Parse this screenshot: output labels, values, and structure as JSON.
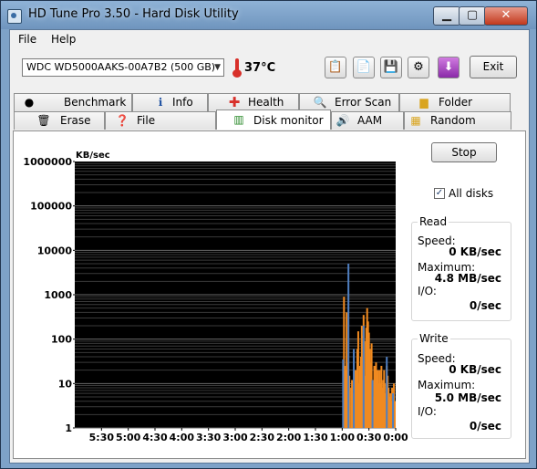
{
  "window": {
    "title": "HD Tune Pro 3.50 - Hard Disk Utility"
  },
  "menu": {
    "file": "File",
    "help": "Help"
  },
  "toolbar": {
    "drive": "WDC WD5000AAKS-00A7B2 (500 GB)",
    "temperature": "37°C",
    "exit_label": "Exit",
    "icons": [
      "copy-icon",
      "copy-info-icon",
      "save-icon",
      "options-icon",
      "download-icon"
    ]
  },
  "tabs": {
    "row1": [
      "Benchmark",
      "Info",
      "Health",
      "Error Scan",
      "Folder Usage"
    ],
    "row2": [
      "Erase",
      "File Benchmark",
      "Disk monitor",
      "AAM",
      "Random Access"
    ],
    "active": "Disk monitor"
  },
  "controls": {
    "stop_label": "Stop",
    "all_disks_label": "All disks",
    "all_disks_checked": true
  },
  "read": {
    "title": "Read",
    "speed_label": "Speed:",
    "speed": "0 KB/sec",
    "max_label": "Maximum:",
    "max": "4.8 MB/sec",
    "io_label": "I/O:",
    "io": "0/sec"
  },
  "write": {
    "title": "Write",
    "speed_label": "Speed:",
    "speed": "0 KB/sec",
    "max_label": "Maximum:",
    "max": "5.0 MB/sec",
    "io_label": "I/O:",
    "io": "0/sec"
  },
  "chart_data": {
    "type": "bar",
    "ylabel": "KB/sec",
    "y_scale": "log",
    "ylim": [
      1,
      1000000
    ],
    "yticks": [
      "1000000",
      "100000",
      "10000",
      "1000",
      "100",
      "10",
      "1"
    ],
    "xticks": [
      "5:30",
      "5:00",
      "4:30",
      "4:00",
      "3:30",
      "3:00",
      "2:30",
      "2:00",
      "1:30",
      "1:00",
      "0:30",
      "0:00"
    ],
    "xlim_seconds_ago": [
      360,
      0
    ],
    "series": [
      {
        "colorkey": "write",
        "color": "#f08a20",
        "points": [
          [
            58,
            900
          ],
          [
            57,
            25
          ],
          [
            56,
            20
          ],
          [
            55,
            400
          ],
          [
            54,
            30
          ],
          [
            52,
            15
          ],
          [
            50,
            8
          ],
          [
            49,
            12
          ],
          [
            48,
            6
          ],
          [
            46,
            8
          ],
          [
            45,
            20
          ],
          [
            44,
            15
          ],
          [
            43,
            60
          ],
          [
            42,
            150
          ],
          [
            41,
            10
          ],
          [
            40,
            25
          ],
          [
            39,
            40
          ],
          [
            38,
            200
          ],
          [
            37,
            120
          ],
          [
            36,
            350
          ],
          [
            35,
            90
          ],
          [
            34,
            15
          ],
          [
            33,
            180
          ],
          [
            32,
            500
          ],
          [
            31,
            250
          ],
          [
            30,
            140
          ],
          [
            29,
            60
          ],
          [
            28,
            30
          ],
          [
            27,
            80
          ],
          [
            26,
            8
          ],
          [
            25,
            5
          ],
          [
            24,
            25
          ],
          [
            23,
            12
          ],
          [
            22,
            30
          ],
          [
            21,
            15
          ],
          [
            20,
            20
          ],
          [
            19,
            10
          ],
          [
            18,
            20
          ],
          [
            17,
            10
          ],
          [
            16,
            25
          ],
          [
            15,
            8
          ],
          [
            14,
            12
          ],
          [
            13,
            20
          ],
          [
            12,
            6
          ],
          [
            11,
            10
          ],
          [
            10,
            25
          ],
          [
            9,
            15
          ],
          [
            8,
            8
          ],
          [
            7,
            5
          ],
          [
            6,
            6
          ],
          [
            5,
            4
          ],
          [
            4,
            8
          ],
          [
            3,
            5
          ],
          [
            2,
            10
          ],
          [
            1,
            4
          ]
        ]
      },
      {
        "colorkey": "read",
        "color": "#4f7fc0",
        "points": [
          [
            59,
            35
          ],
          [
            53,
            5000
          ],
          [
            47,
            60
          ],
          [
            36,
            200
          ],
          [
            26,
            12
          ],
          [
            10,
            40
          ],
          [
            3,
            6
          ]
        ]
      }
    ]
  }
}
